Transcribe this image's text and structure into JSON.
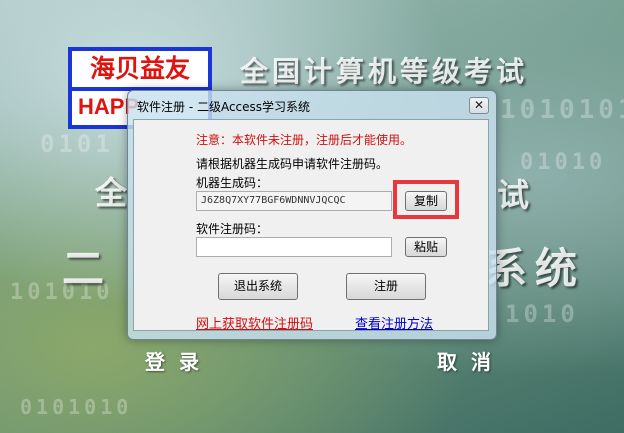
{
  "background": {
    "exam_title": "全国计算机等级考试",
    "fragment_left_1": "全",
    "fragment_right_1": "试",
    "fragment_left_2": "二",
    "fragment_right_2": "系统",
    "binary_rows": [
      "1010101",
      "0101",
      "01010",
      "101010",
      "1010",
      "0101010"
    ],
    "login_label": "登录",
    "cancel_label": "取消"
  },
  "logo": {
    "brand_cn": "海贝益友",
    "brand_en": "HAPP"
  },
  "dialog": {
    "title": "软件注册 - 二级Access学习系统",
    "close_glyph": "✕",
    "warning": "注意：本软件未注册，注册后才能使用。",
    "instruction": "请根据机器生成码申请软件注册码。",
    "machine_code_label": "机器生成码：",
    "machine_code_value": "J6Z8Q7XY77BGF6WDNNVJQCQC",
    "copy_button": "复制",
    "reg_code_label": "软件注册码：",
    "reg_code_value": "",
    "paste_button": "粘贴",
    "exit_button": "退出系统",
    "register_button": "注册",
    "get_code_link": "网上获取软件注册码",
    "view_method_link": "查看注册方法"
  },
  "colors": {
    "warning_red": "#d01010",
    "highlight_red": "#e8383b",
    "link_blue": "#0000cc",
    "logo_blue": "#1a35d8"
  }
}
